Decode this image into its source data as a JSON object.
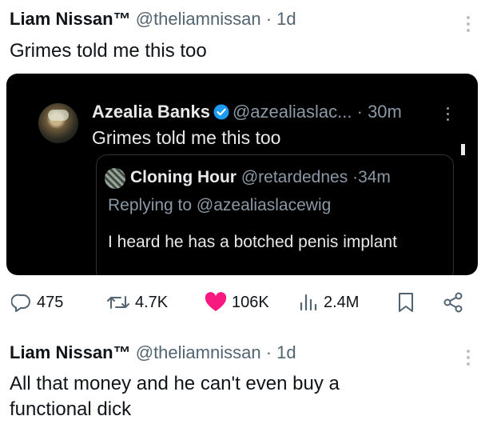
{
  "post1": {
    "author_name": "Liam Nissan™",
    "handle": "@theliamnissan",
    "separator": "·",
    "time": "1d",
    "text": "Grimes told me this too"
  },
  "screenshot": {
    "author_name": "Azealia Banks",
    "handle": "@azealiaslac...",
    "separator": "·",
    "time": "30m",
    "text": "Grimes told me this too",
    "quote": {
      "author_name": "Cloning Hour",
      "handle": "@retardednes",
      "separator": "·",
      "time": "34m",
      "replying_to": "Replying to @azealiaslacewig",
      "text": "I heard he has a botched penis implant"
    }
  },
  "actions": {
    "replies": "475",
    "reposts": "4.7K",
    "likes": "106K",
    "views": "2.4M"
  },
  "post2": {
    "author_name": "Liam Nissan™",
    "handle": "@theliamnissan",
    "separator": "·",
    "time": "1d",
    "text": "All that money and he can't even buy a functional dick"
  },
  "colors": {
    "text_primary": "#0f1419",
    "text_secondary": "#536471",
    "dark_bg": "#000000",
    "dark_text": "#e7e9ea",
    "verified_blue": "#1d9bf0",
    "like_pink": "#f91880"
  },
  "icons": [
    "more-icon",
    "verified-icon",
    "reply-icon",
    "repost-icon",
    "like-icon",
    "views-icon",
    "bookmark-icon",
    "share-icon"
  ]
}
